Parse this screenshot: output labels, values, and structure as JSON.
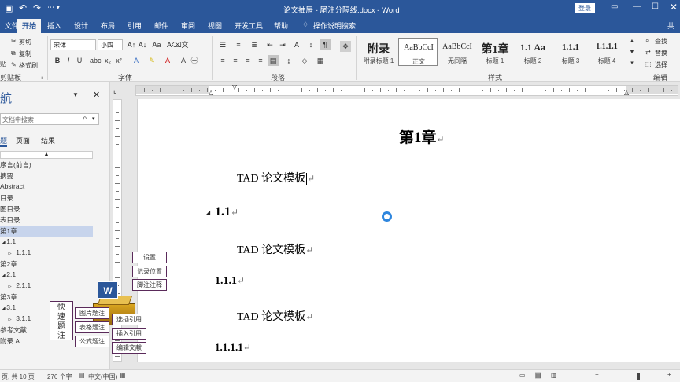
{
  "window": {
    "title": "论文抽屉 - 尾注分隔线.docx - Word",
    "login_label": "登录"
  },
  "tabs": [
    "文件",
    "开始",
    "插入",
    "设计",
    "布局",
    "引用",
    "邮件",
    "审阅",
    "视图",
    "开发工具",
    "帮助"
  ],
  "tell_me": "操作说明搜索",
  "share_label": "共",
  "clipboard": {
    "cut": "剪切",
    "copy": "复制",
    "format_painter": "格式刷",
    "paste_stub": "贴",
    "label": "剪贴板"
  },
  "font": {
    "name": "宋体",
    "size": "小四",
    "label": "字体"
  },
  "paragraph": {
    "label": "段落"
  },
  "styles": {
    "label": "样式",
    "items": [
      {
        "preview": "附录",
        "name": "附录标题 1"
      },
      {
        "preview": "AaBbCcI",
        "name": "正文"
      },
      {
        "preview": "AaBbCcI",
        "name": "无间隔"
      },
      {
        "preview": "第1章",
        "name": "标题 1"
      },
      {
        "preview": "1.1 Aa",
        "name": "标题 2"
      },
      {
        "preview": "1.1.1",
        "name": "标题 3"
      },
      {
        "preview": "1.1.1.1",
        "name": "标题 4"
      }
    ]
  },
  "editing": {
    "find": "查找",
    "replace": "替换",
    "select": "选择",
    "label": "编辑"
  },
  "nav": {
    "title": "航",
    "search_placeholder": "文档中搜索",
    "tabs": [
      "题",
      "页面",
      "结果"
    ],
    "items": [
      {
        "label": "序言(前言)",
        "indent": 0
      },
      {
        "label": "摘要",
        "indent": 0
      },
      {
        "label": "Abstract",
        "indent": 0
      },
      {
        "label": "目录",
        "indent": 0
      },
      {
        "label": "图目录",
        "indent": 0
      },
      {
        "label": "表目录",
        "indent": 0
      },
      {
        "label": "第1章",
        "indent": 0,
        "active": true
      },
      {
        "label": "1.1",
        "indent": 1
      },
      {
        "label": "1.1.1",
        "indent": 2
      },
      {
        "label": "第2章",
        "indent": 0
      },
      {
        "label": "2.1",
        "indent": 1
      },
      {
        "label": "2.1.1",
        "indent": 2
      },
      {
        "label": "第3章",
        "indent": 0
      },
      {
        "label": "3.1",
        "indent": 1
      },
      {
        "label": "3.1.1",
        "indent": 2
      },
      {
        "label": "参考文献",
        "indent": 0
      },
      {
        "label": "附录 A",
        "indent": 0
      }
    ]
  },
  "document": {
    "heading1": "第1章",
    "body1": "TAD 论文模板",
    "heading2": "1.1",
    "body2": "TAD 论文模板",
    "heading3": "1.1.1",
    "body3": "TAD 论文模板",
    "heading4": "1.1.1.1",
    "para_mark": "↵"
  },
  "overlay": {
    "settings": "设置",
    "record_position": "记录位置",
    "footnote_note": "脚注注释",
    "quick_caption": "快速题注",
    "figure_caption": "图片题注",
    "table_caption": "表格题注",
    "equation_caption": "公式题注",
    "select_cite": "选插引用",
    "insert_cite": "插入引用",
    "edit_refs": "编辑文献"
  },
  "status": {
    "page": "页, 共 10 页",
    "words": "276 个字",
    "language": "中文(中国)"
  },
  "colors": {
    "accent": "#2b579a",
    "overlay_border": "#5a2a5a"
  }
}
